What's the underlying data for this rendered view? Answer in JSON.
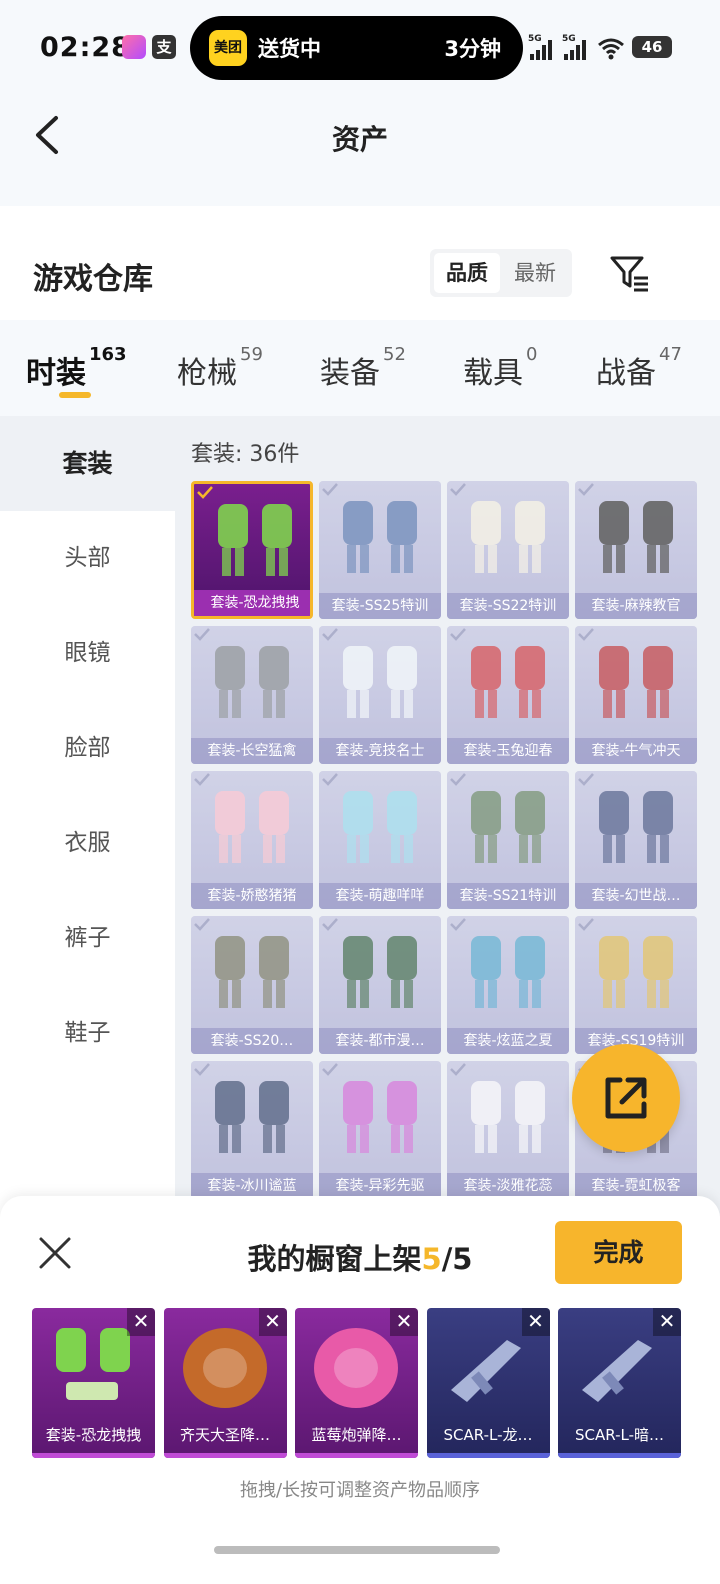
{
  "status_bar": {
    "time": "02:28",
    "delivery_brand": "美团",
    "delivery_status": "送货中",
    "delivery_eta": "3分钟",
    "app_badge": "支",
    "signal1": "5G",
    "signal2": "5G",
    "battery": "46"
  },
  "header": {
    "title": "资产"
  },
  "warehouse": {
    "title": "游戏仓库",
    "sort_options": [
      "品质",
      "最新"
    ],
    "active_sort": "品质"
  },
  "tabs": [
    {
      "label": "时装",
      "count": "163"
    },
    {
      "label": "枪械",
      "count": "59"
    },
    {
      "label": "装备",
      "count": "52"
    },
    {
      "label": "载具",
      "count": "0"
    },
    {
      "label": "战备",
      "count": "47"
    }
  ],
  "sidebar": {
    "items": [
      "套装",
      "头部",
      "眼镜",
      "脸部",
      "衣服",
      "裤子",
      "鞋子"
    ]
  },
  "main": {
    "count_label": "套装: 36件",
    "items": [
      "套装-恐龙拽拽",
      "套装-SS25特训",
      "套装-SS22特训",
      "套装-麻辣教官",
      "套装-长空猛禽",
      "套装-竞技名士",
      "套装-玉兔迎春",
      "套装-牛气冲天",
      "套装-娇憨猪猪",
      "套装-萌趣咩咩",
      "套装-SS21特训",
      "套装-幻世战…",
      "套装-SS20…",
      "套装-都市漫…",
      "套装-炫蓝之夏",
      "套装-SS19特训",
      "套装-冰川谧蓝",
      "套装-异彩先驱",
      "套装-淡雅花蕊",
      "套装-霓虹极客"
    ]
  },
  "sheet": {
    "title_prefix": "我的橱窗上架",
    "current": "5",
    "total": "/5",
    "done_label": "完成",
    "close_glyph": "✕",
    "remove_glyph": "✕",
    "shelf": [
      {
        "label": "套装-恐龙拽拽",
        "style": "purple"
      },
      {
        "label": "齐天大圣降…",
        "style": "purple"
      },
      {
        "label": "蓝莓炮弹降…",
        "style": "purple"
      },
      {
        "label": "SCAR-L-龙…",
        "style": "blue"
      },
      {
        "label": "SCAR-L-暗…",
        "style": "blue"
      }
    ],
    "hint": "拖拽/长按可调整资产物品顺序"
  },
  "colors": {
    "accent": "#f7b52c",
    "selected_border": "#f5b72a"
  }
}
